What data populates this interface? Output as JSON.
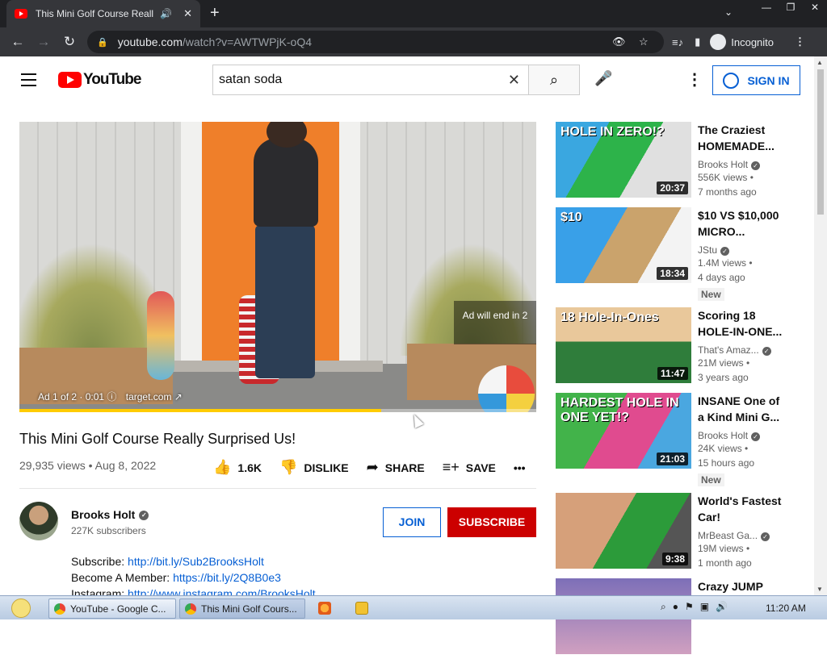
{
  "browser": {
    "tab_title": "This Mini Golf Course Really",
    "url_host": "youtube.com",
    "url_path": "/watch?v=AWTWPjK-oQ4",
    "profile_label": "Incognito"
  },
  "youtube": {
    "logo_text": "YouTube",
    "search_query": "satan soda",
    "signin_label": "SIGN IN"
  },
  "player": {
    "ad_end_text": "Ad will end in 2",
    "ad_info": "Ad 1 of 2 · 0:01",
    "ad_domain": "target.com",
    "progress_fraction": 0.7
  },
  "video": {
    "title": "This Mini Golf Course Really Surprised Us!",
    "meta": "29,935 views • Aug 8, 2022",
    "likes": "1.6K",
    "dislike_label": "DISLIKE",
    "share_label": "SHARE",
    "save_label": "SAVE"
  },
  "channel": {
    "name": "Brooks Holt",
    "subs": "227K subscribers",
    "join_label": "JOIN",
    "subscribe_label": "SUBSCRIBE"
  },
  "description": {
    "l1_label": "Subscribe: ",
    "l1_link": "http://bit.ly/Sub2BrooksHolt",
    "l2_label": "Become A Member: ",
    "l2_link": "https://bit.ly/2Q8B0e3",
    "l3_label": "Instagram: ",
    "l3_link": "http://www.instagram.com/BrooksHolt"
  },
  "recommendations": [
    {
      "title1": "The Craziest",
      "title2": "HOMEMADE...",
      "channel": "Brooks Holt",
      "verified": true,
      "views": "556K views •",
      "age": "7 months ago",
      "duration": "20:37",
      "overlay": "HOLE IN ZERO!?",
      "new": ""
    },
    {
      "title1": "$10 VS $10,000",
      "title2": "MICRO...",
      "channel": "JStu",
      "verified": true,
      "views": "1.4M views •",
      "age": "4 days ago",
      "duration": "18:34",
      "overlay": "$10",
      "new": "New"
    },
    {
      "title1": "Scoring 18",
      "title2": "HOLE-IN-ONE...",
      "channel": "That's Amaz...",
      "verified": true,
      "views": "21M views •",
      "age": "3 years ago",
      "duration": "11:47",
      "overlay": "18 Hole-In-Ones",
      "new": ""
    },
    {
      "title1": "INSANE One of",
      "title2": "a Kind Mini G...",
      "channel": "Brooks Holt",
      "verified": true,
      "views": "24K views •",
      "age": "15 hours ago",
      "duration": "21:03",
      "overlay": "HARDEST HOLE IN ONE YET!?",
      "new": "New"
    },
    {
      "title1": "World's Fastest",
      "title2": "Car!",
      "channel": "MrBeast Ga...",
      "verified": true,
      "views": "19M views •",
      "age": "1 month ago",
      "duration": "9:38",
      "overlay": "",
      "new": ""
    },
    {
      "title1": "Crazy JUMP",
      "title2": "",
      "channel": "",
      "verified": false,
      "views": "",
      "age": "",
      "duration": "",
      "overlay": "",
      "new": ""
    }
  ],
  "taskbar": {
    "btn1": "YouTube - Google C...",
    "btn2": "This Mini Golf Cours...",
    "time": "11:20 AM"
  }
}
